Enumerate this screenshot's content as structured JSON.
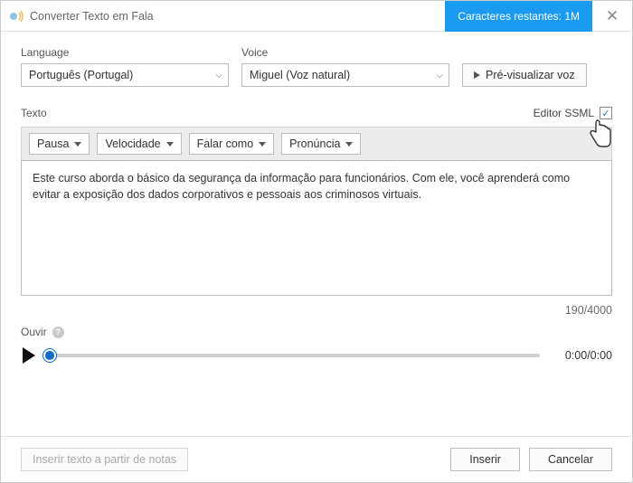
{
  "titlebar": {
    "title": "Converter Texto em Fala",
    "char_banner": "Caracteres restantes: 1M"
  },
  "form": {
    "language_label": "Language",
    "language_value": "Português (Portugal)",
    "voice_label": "Voice",
    "voice_value": "Miguel (Voz natural)",
    "preview_btn": "Pré-visualizar voz"
  },
  "texto": {
    "label": "Texto",
    "editor_ssml_label": "Editor SSML",
    "toolbar": {
      "pausa": "Pausa",
      "velocidade": "Velocidade",
      "falar_como": "Falar como",
      "pronuncia": "Pronúncia"
    },
    "content": "Este curso aborda o básico da segurança da informação para funcionários. Com ele, você aprenderá como evitar a exposição dos dados corporativos e pessoais aos criminosos virtuais.",
    "counter": "190/4000"
  },
  "ouvir": {
    "label": "Ouvir",
    "time": "0:00/0:00"
  },
  "footer": {
    "insert_notes": "Inserir texto a partir de notas",
    "inserir": "Inserir",
    "cancelar": "Cancelar"
  }
}
